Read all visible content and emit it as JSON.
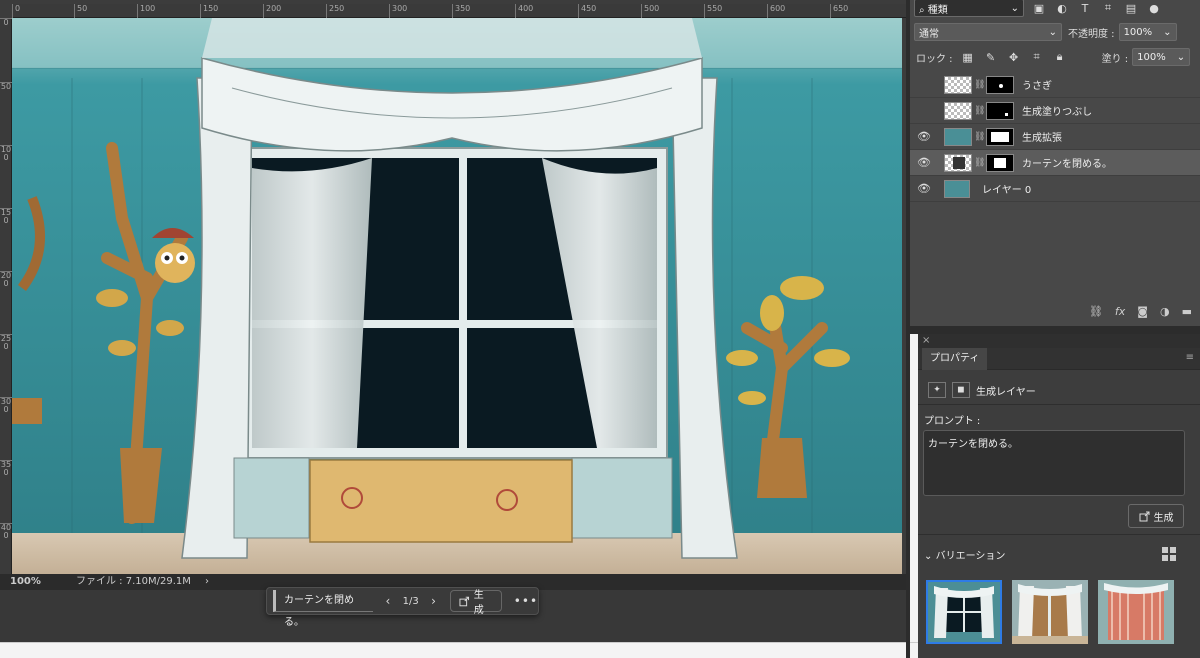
{
  "ruler": {
    "top_ticks": [
      "0",
      "50",
      "100",
      "150",
      "200",
      "250",
      "300",
      "350",
      "400",
      "450",
      "500",
      "550",
      "600",
      "650"
    ],
    "left_ticks": [
      "0",
      "50",
      "100",
      "150",
      "200",
      "250",
      "300",
      "350",
      "400"
    ]
  },
  "status_bar": {
    "zoom": "100%",
    "file_info": "ファイル : 7.10M/29.1M",
    "arrow": "›"
  },
  "contextual_taskbar": {
    "prompt": "カーテンを閉める。",
    "prev": "‹",
    "next": "›",
    "count": "1/3",
    "generate_label": "生成",
    "more": "•••"
  },
  "layers_panel": {
    "filter_kind": "種類",
    "blend_mode": "通常",
    "opacity_label": "不透明度 :",
    "opacity_value": "100%",
    "lock_label": "ロック :",
    "fill_label": "塗り :",
    "fill_value": "100%",
    "layers": [
      {
        "name": "うさぎ",
        "visible": false
      },
      {
        "name": "生成塗りつぶし",
        "visible": false
      },
      {
        "name": "生成拡張",
        "visible": true
      },
      {
        "name": "カーテンを閉める。",
        "visible": true,
        "active": true
      },
      {
        "name": "レイヤー 0",
        "visible": true
      }
    ],
    "footer_icons": [
      "link-icon",
      "fx-icon",
      "mask-icon",
      "adjustment-icon",
      "folder-icon"
    ],
    "footer_fx": "fx"
  },
  "properties_panel": {
    "close_glyph": "×",
    "tab_label": "プロパティ",
    "layer_type_label": "生成レイヤー",
    "prompt_label": "プロンプト :",
    "prompt_text": "カーテンを閉める。",
    "generate_label": "生成",
    "variations_label": "バリエーション",
    "variation_count": 3,
    "selected_variation": 1
  },
  "colors": {
    "accent_blue": "#2e7be6",
    "panel_bg": "#484848",
    "canvas_wall": "#3f8b93"
  }
}
